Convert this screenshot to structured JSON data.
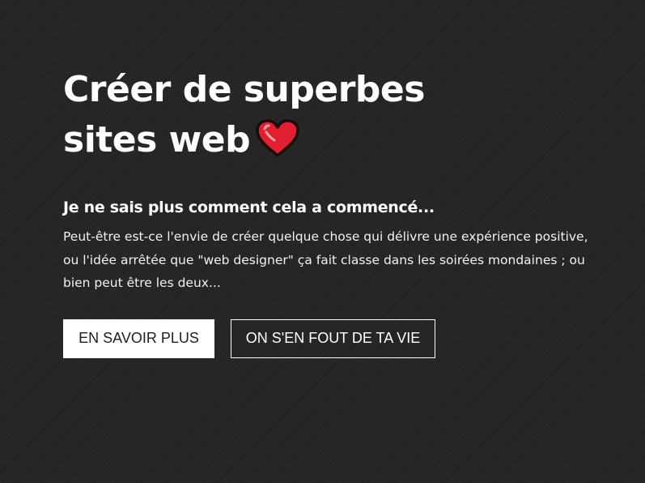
{
  "hero": {
    "title": "Créer de superbes sites web",
    "heart_icon": "red-heart-emoji",
    "subtitle": "Je ne sais plus comment cela a commencé...",
    "description": "Peut-être est-ce l'envie de créer quelque chose qui délivre une expérience positive, ou l'idée arrêtée que \"web designer\" ça fait classe dans les soirées mondaines ; ou bien peut être les deux...",
    "primary_button": "EN SAVOIR PLUS",
    "secondary_button": "ON S'EN FOUT DE TA VIE"
  },
  "colors": {
    "background": "#262626",
    "text": "#ffffff",
    "heart": "#e0202f",
    "heart_outline": "#1a0a0a",
    "primary_button_bg": "#ffffff",
    "primary_button_text": "#1f1f1f"
  }
}
